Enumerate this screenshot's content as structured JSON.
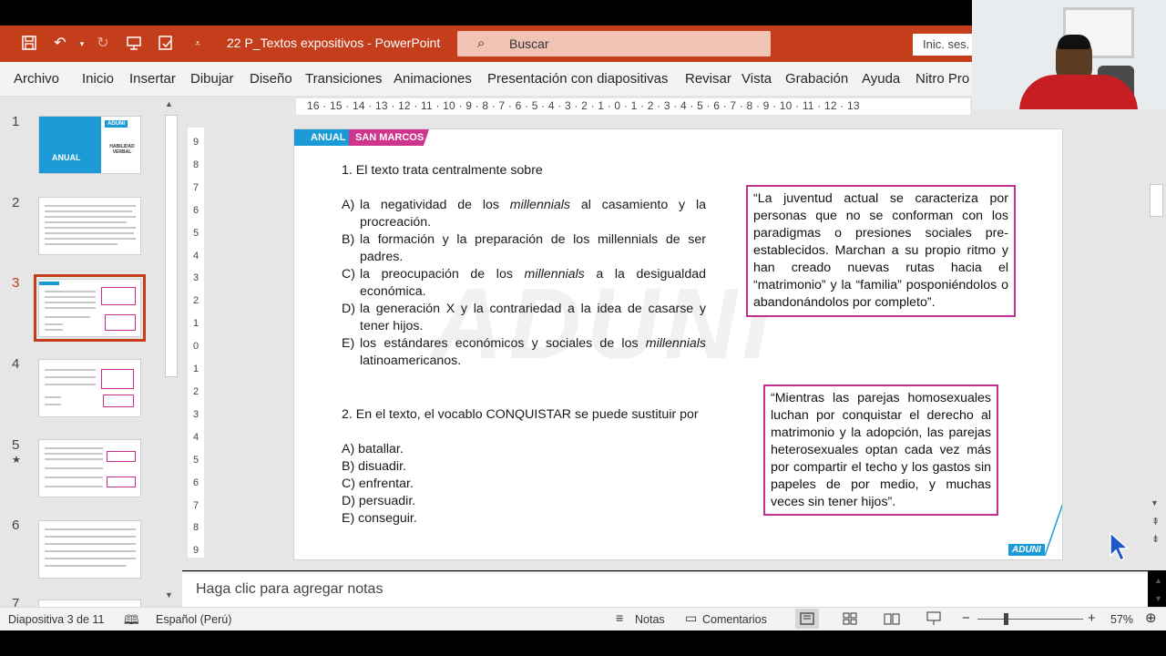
{
  "app": {
    "doc_title": "22 P_Textos expositivos  -  PowerPoint",
    "search_placeholder": "Buscar",
    "signin": "Inic. ses."
  },
  "menu": [
    "Archivo",
    "Inicio",
    "Insertar",
    "Dibujar",
    "Diseño",
    "Transiciones",
    "Animaciones",
    "Presentación con diapositivas",
    "Revisar",
    "Vista",
    "Grabación",
    "Ayuda",
    "Nitro Pro"
  ],
  "thumbnails": [
    {
      "num": "1",
      "badge": "ADUNI",
      "title": "ANUAL",
      "subtitle": "HABILIDAD VERBAL"
    },
    {
      "num": "2"
    },
    {
      "num": "3"
    },
    {
      "num": "4"
    },
    {
      "num": "5"
    },
    {
      "num": "6"
    },
    {
      "num": "7"
    }
  ],
  "ruler": {
    "h": "16 · 15 · 14 · 13 · 12 · 11 · 10 · 9 · 8 · 7 · 6 · 5 · 4 · 3 · 2 · 1 · 0 · 1 · 2 · 3 · 4 · 5 · 6 · 7 · 8 · 9 · 10 · 11 · 12 · 13",
    "v": [
      "9",
      "8",
      "7",
      "6",
      "5",
      "4",
      "3",
      "2",
      "1",
      "0",
      "1",
      "2",
      "3",
      "4",
      "5",
      "6",
      "7",
      "8",
      "9"
    ]
  },
  "slide": {
    "tag_left": "ANUAL",
    "tag_right": "SAN MARCOS",
    "q1": "1.   El texto trata centralmente sobre",
    "q1_options": [
      {
        "letter": "A)",
        "pre": "la negatividad de los ",
        "em": "millennials",
        "post": " al casamiento y la procreación."
      },
      {
        "letter": "B)",
        "pre": "la formación y la preparación de los millennials de ser padres.",
        "em": "",
        "post": ""
      },
      {
        "letter": "C)",
        "pre": "la preocupación de los ",
        "em": "millennials",
        "post": " a la desigualdad económica."
      },
      {
        "letter": "D)",
        "pre": "la generación X y la contrariedad a la idea de casarse y tener hijos.",
        "em": "",
        "post": ""
      },
      {
        "letter": "E)",
        "pre": "los estándares económicos y sociales de los ",
        "em": "millennials",
        "post": " latinoamericanos."
      }
    ],
    "q2": "2. En el texto, el vocablo CONQUISTAR se puede sustituir por",
    "q2_options": [
      "A)   batallar.",
      "B)   disuadir.",
      "C)   enfrentar.",
      "D)   persuadir.",
      "E)   conseguir."
    ],
    "quote1": "“La juventud actual se caracteriza por personas que no se conforman con los paradigmas o presiones sociales pre-establecidos. Marchan a su propio ritmo y han creado nuevas rutas hacia el “matrimonio” y la “familia” posponiéndolos o abandonándolos por completo”.",
    "quote2": "“Mientras las parejas homosexuales luchan por conquistar el derecho al matrimonio y la adopción, las parejas heterosexuales optan cada vez más por compartir el techo y los gastos sin papeles de por medio, y muchas veces sin tener hijos”.",
    "watermark": "ADUNI",
    "logo": "ADUNI"
  },
  "notes_placeholder": "Haga clic para agregar notas",
  "status": {
    "slide_info": "Diapositiva 3 de 11",
    "language": "Español (Perú)",
    "notes": "Notas",
    "comments": "Comentarios",
    "zoom": "57%"
  },
  "colors": {
    "accent": "#c43e1c",
    "tag_blue": "#1a9bd7",
    "tag_pink": "#d0358e",
    "quote_border": "#c2318d"
  }
}
